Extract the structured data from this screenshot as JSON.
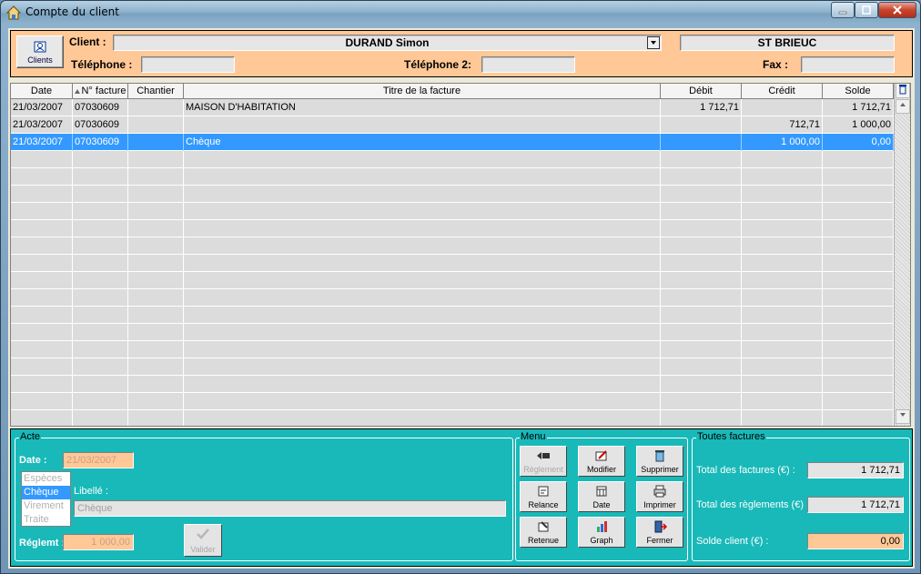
{
  "window": {
    "title": "Compte du client",
    "icon": "house-icon"
  },
  "header": {
    "clients_button": "Clients",
    "client_label": "Client :",
    "client_value": "DURAND Simon",
    "city_value": "ST BRIEUC",
    "telephone_label": "Téléphone :",
    "telephone_value": "",
    "telephone2_label": "Téléphone 2:",
    "telephone2_value": "",
    "fax_label": "Fax :",
    "fax_value": ""
  },
  "grid": {
    "columns": [
      "Date",
      "N° facture",
      "Chantier",
      "Titre de la facture",
      "Débit",
      "Crédit",
      "Solde"
    ],
    "rows": [
      {
        "date": "21/03/2007",
        "num": "07030609",
        "chantier": "",
        "titre": "MAISON D'HABITATION",
        "debit": "1 712,71",
        "credit": "",
        "solde": "1 712,71",
        "selected": false
      },
      {
        "date": "21/03/2007",
        "num": "07030609",
        "chantier": "",
        "titre": "",
        "debit": "",
        "credit": "712,71",
        "solde": "1 000,00",
        "selected": false
      },
      {
        "date": "21/03/2007",
        "num": "07030609",
        "chantier": "",
        "titre": "Chèque",
        "debit": "",
        "credit": "1 000,00",
        "solde": "0,00",
        "selected": true
      }
    ],
    "empty_rows": 16
  },
  "acte": {
    "legend": "Acte",
    "date_label": "Date :",
    "date_value": "21/03/2007",
    "payment_types": [
      "Espèces",
      "Chèque",
      "Virement",
      "Traite"
    ],
    "selected_type": "Chèque",
    "libelle_label": "Libellé :",
    "libelle_value": "Chèque",
    "reglement_label": "Réglemt :",
    "reglement_value": "1 000,00",
    "valider_label": "Valider"
  },
  "menu": {
    "legend": "Menu",
    "buttons": [
      {
        "label": "Règlement",
        "icon": "payment-icon",
        "enabled": false
      },
      {
        "label": "Modifier",
        "icon": "edit-icon",
        "enabled": true
      },
      {
        "label": "Supprimer",
        "icon": "trash-icon",
        "enabled": true
      },
      {
        "label": "Relance",
        "icon": "reminder-icon",
        "enabled": true
      },
      {
        "label": "Date",
        "icon": "calendar-icon",
        "enabled": true
      },
      {
        "label": "Imprimer",
        "icon": "printer-icon",
        "enabled": true
      },
      {
        "label": "Retenue",
        "icon": "retention-icon",
        "enabled": true
      },
      {
        "label": "Graph",
        "icon": "graph-icon",
        "enabled": true
      },
      {
        "label": "Fermer",
        "icon": "door-exit-icon",
        "enabled": true
      }
    ]
  },
  "totals": {
    "legend": "Toutes factures",
    "factures_label": "Total des factures (€) :",
    "factures_value": "1 712,71",
    "reglements_label": "Total des règlements (€) :",
    "reglements_value": "1 712,71",
    "solde_label": "Solde client (€) :",
    "solde_value": "0,00"
  },
  "colors": {
    "header_bg": "#ffc896",
    "teal_bg": "#19b9b9",
    "selection": "#3399ff"
  }
}
